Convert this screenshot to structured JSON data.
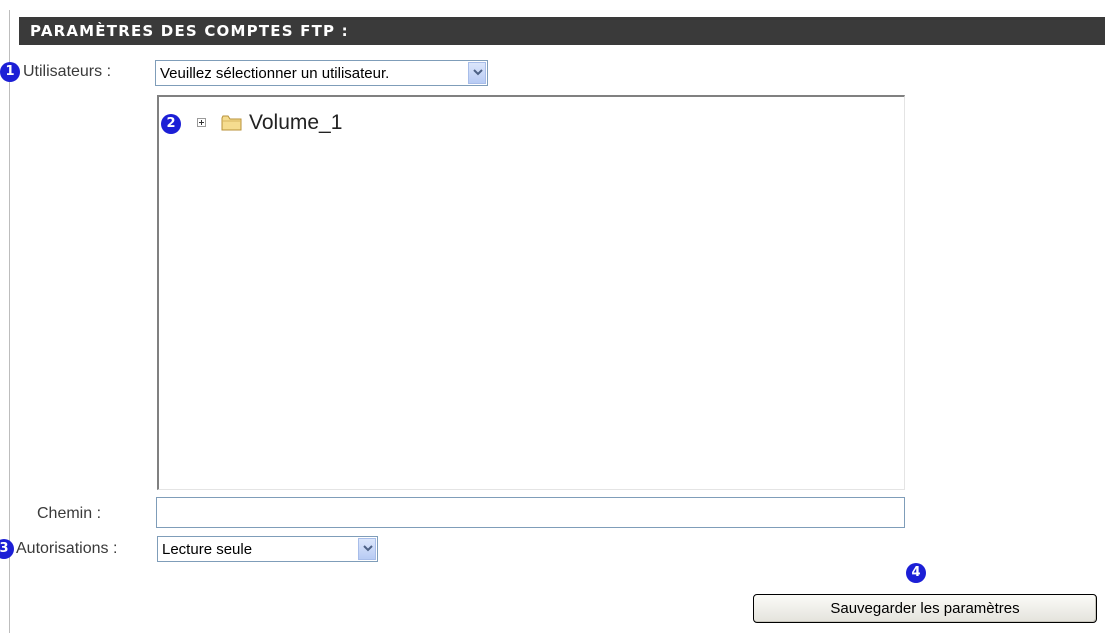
{
  "header": {
    "title": "PARAMÈTRES DES COMPTES FTP :"
  },
  "badges": {
    "one": "1",
    "two": "2",
    "three": "3",
    "four": "4"
  },
  "users": {
    "label": "Utilisateurs :",
    "selected": "Veuillez sélectionner un utilisateur."
  },
  "tree": {
    "root_label": "Volume_1",
    "expander_icon": "plus-box-icon",
    "folder_icon": "folder-icon"
  },
  "path": {
    "label": "Chemin :",
    "value": ""
  },
  "permissions": {
    "label": "Autorisations :",
    "selected": "Lecture seule"
  },
  "save_button": {
    "label": "Sauvegarder les paramètres"
  },
  "colors": {
    "header_bg": "#3a3a3a",
    "badge": "#1c1fd6",
    "input_border": "#7f9db9"
  }
}
